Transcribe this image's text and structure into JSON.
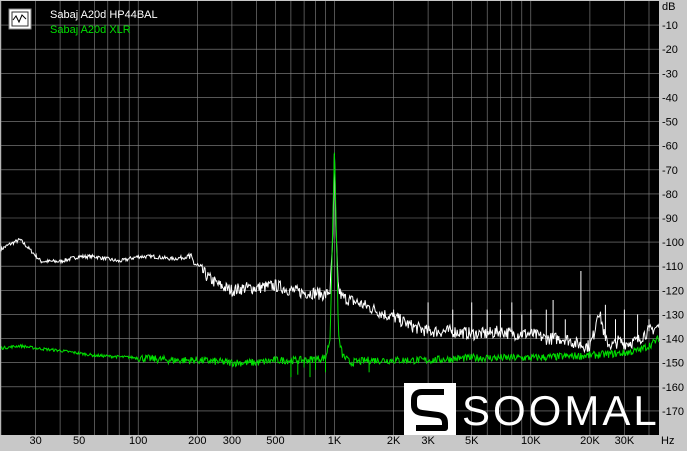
{
  "chart_data": {
    "type": "line",
    "xscale": "log",
    "xlim": [
      20,
      45000
    ],
    "ylim": [
      -180,
      0
    ],
    "grid": true,
    "legend_position": "top-left",
    "y_unit": "dB",
    "x_unit": "Hz",
    "y_ticks": [
      -10,
      -20,
      -30,
      -40,
      -50,
      -60,
      -70,
      -80,
      -90,
      -100,
      -110,
      -120,
      -130,
      -140,
      -150,
      -160,
      -170
    ],
    "x_ticks": [
      {
        "v": 30,
        "label": "30"
      },
      {
        "v": 50,
        "label": "50"
      },
      {
        "v": 100,
        "label": "100"
      },
      {
        "v": 200,
        "label": "200"
      },
      {
        "v": 300,
        "label": "300"
      },
      {
        "v": 500,
        "label": "500"
      },
      {
        "v": 1000,
        "label": "1K"
      },
      {
        "v": 2000,
        "label": "2K"
      },
      {
        "v": 3000,
        "label": "3K"
      },
      {
        "v": 5000,
        "label": "5K"
      },
      {
        "v": 10000,
        "label": "10K"
      },
      {
        "v": 20000,
        "label": "20K"
      },
      {
        "v": 30000,
        "label": "30K"
      }
    ],
    "series": [
      {
        "name": "Sabaj A20d HP44BAL",
        "color": "#ffffff",
        "points": [
          [
            20,
            -103
          ],
          [
            22,
            -101
          ],
          [
            25,
            -99
          ],
          [
            28,
            -103
          ],
          [
            32,
            -108
          ],
          [
            36,
            -108
          ],
          [
            40,
            -108
          ],
          [
            50,
            -106
          ],
          [
            60,
            -106
          ],
          [
            70,
            -107
          ],
          [
            80,
            -108
          ],
          [
            100,
            -106
          ],
          [
            120,
            -106
          ],
          [
            150,
            -107
          ],
          [
            180,
            -106
          ],
          [
            200,
            -110
          ],
          [
            230,
            -115
          ],
          [
            260,
            -118
          ],
          [
            300,
            -120
          ],
          [
            350,
            -119
          ],
          [
            400,
            -119
          ],
          [
            500,
            -118
          ],
          [
            600,
            -120
          ],
          [
            700,
            -121
          ],
          [
            800,
            -121
          ],
          [
            900,
            -122
          ],
          [
            950,
            -120
          ],
          [
            980,
            -100
          ],
          [
            1000,
            -61
          ],
          [
            1020,
            -100
          ],
          [
            1050,
            -120
          ],
          [
            1100,
            -123
          ],
          [
            1300,
            -125
          ],
          [
            1500,
            -127
          ],
          [
            1800,
            -130
          ],
          [
            2000,
            -131
          ],
          [
            2500,
            -135
          ],
          [
            3000,
            -137
          ],
          [
            4000,
            -137
          ],
          [
            5000,
            -138
          ],
          [
            6000,
            -138
          ],
          [
            7000,
            -137
          ],
          [
            8000,
            -138
          ],
          [
            9000,
            -138
          ],
          [
            10000,
            -138
          ],
          [
            12000,
            -140
          ],
          [
            15000,
            -140
          ],
          [
            17000,
            -142
          ],
          [
            19000,
            -143
          ],
          [
            20000,
            -143
          ],
          [
            21000,
            -138
          ],
          [
            22000,
            -128
          ],
          [
            23000,
            -133
          ],
          [
            24000,
            -141
          ],
          [
            26000,
            -143
          ],
          [
            28000,
            -141
          ],
          [
            30000,
            -142
          ],
          [
            35000,
            -141
          ],
          [
            38000,
            -138
          ],
          [
            42000,
            -136
          ],
          [
            45000,
            -135
          ]
        ],
        "spikes": [
          [
            2000,
            -128
          ],
          [
            3000,
            -125
          ],
          [
            4000,
            -128
          ],
          [
            5000,
            -125
          ],
          [
            6000,
            -128
          ],
          [
            7000,
            -128
          ],
          [
            8000,
            -125
          ],
          [
            9000,
            -130
          ],
          [
            10000,
            -128
          ],
          [
            12000,
            -128
          ],
          [
            13000,
            -124
          ],
          [
            15000,
            -132
          ],
          [
            18000,
            -112
          ],
          [
            20000,
            -130
          ],
          [
            24000,
            -126
          ],
          [
            27000,
            -132
          ],
          [
            30000,
            -128
          ],
          [
            35000,
            -130
          ],
          [
            40000,
            -132
          ]
        ]
      },
      {
        "name": "Sabaj A20d XLR",
        "color": "#00e000",
        "points": [
          [
            20,
            -144
          ],
          [
            25,
            -143
          ],
          [
            30,
            -144
          ],
          [
            40,
            -145
          ],
          [
            60,
            -147
          ],
          [
            100,
            -148
          ],
          [
            150,
            -149
          ],
          [
            200,
            -149
          ],
          [
            300,
            -150
          ],
          [
            400,
            -150
          ],
          [
            500,
            -149
          ],
          [
            700,
            -149
          ],
          [
            900,
            -148
          ],
          [
            950,
            -140
          ],
          [
            1000,
            -61
          ],
          [
            1050,
            -140
          ],
          [
            1100,
            -147
          ],
          [
            1200,
            -150
          ],
          [
            1500,
            -149
          ],
          [
            2000,
            -149
          ],
          [
            3000,
            -149
          ],
          [
            5000,
            -148
          ],
          [
            10000,
            -148
          ],
          [
            20000,
            -147
          ],
          [
            30000,
            -146
          ],
          [
            35000,
            -145
          ],
          [
            40000,
            -143
          ],
          [
            45000,
            -140
          ]
        ],
        "spikes": [
          [
            600,
            -156
          ],
          [
            650,
            -155
          ],
          [
            700,
            -152
          ],
          [
            750,
            -156
          ],
          [
            800,
            -153
          ],
          [
            900,
            -154
          ],
          [
            1500,
            -154
          ]
        ]
      }
    ]
  },
  "watermark": "SOOMAL"
}
